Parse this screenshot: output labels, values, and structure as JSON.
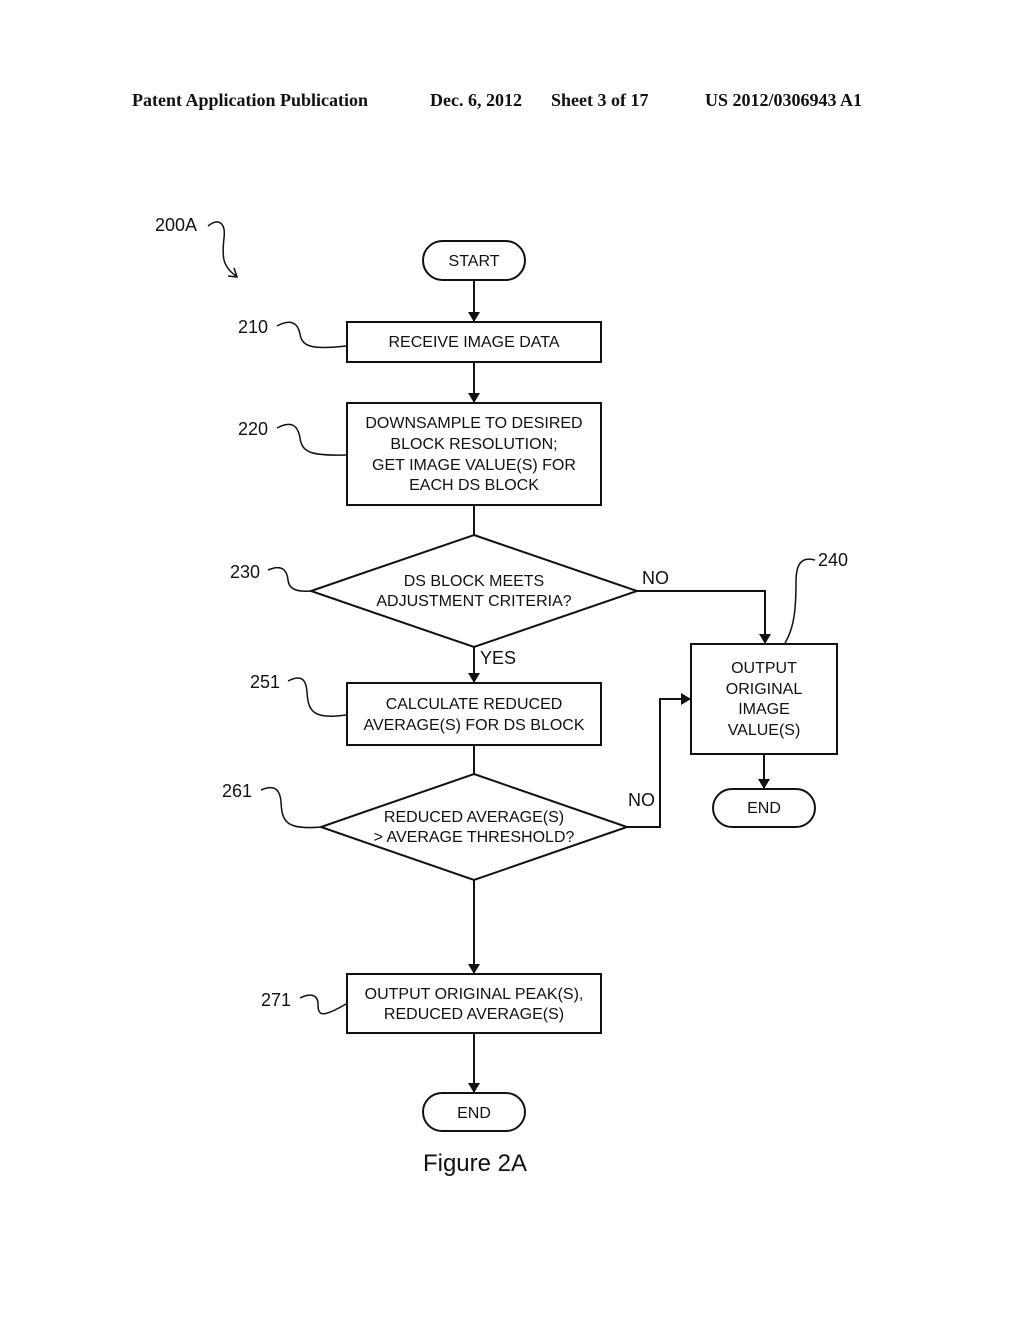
{
  "header": {
    "publication": "Patent Application Publication",
    "date": "Dec. 6, 2012",
    "sheet": "Sheet 3 of 17",
    "number": "US 2012/0306943 A1"
  },
  "figure": {
    "ref": "200A",
    "caption": "Figure 2A"
  },
  "nodes": {
    "start": {
      "text": "START"
    },
    "n210": {
      "ref": "210",
      "lines": [
        "RECEIVE IMAGE DATA"
      ]
    },
    "n220": {
      "ref": "220",
      "lines": [
        "DOWNSAMPLE TO DESIRED",
        "BLOCK RESOLUTION;",
        "GET IMAGE VALUE(S) FOR",
        "EACH DS BLOCK"
      ]
    },
    "n230": {
      "ref": "230",
      "lines": [
        "DS BLOCK MEETS",
        "ADJUSTMENT CRITERIA?"
      ]
    },
    "n240": {
      "ref": "240",
      "lines": [
        "OUTPUT",
        "ORIGINAL",
        "IMAGE",
        "VALUE(S)"
      ]
    },
    "n251": {
      "ref": "251",
      "lines": [
        "CALCULATE REDUCED",
        "AVERAGE(S) FOR DS BLOCK"
      ]
    },
    "n261": {
      "ref": "261",
      "lines": [
        "REDUCED AVERAGE(S)",
        "> AVERAGE THRESHOLD?"
      ]
    },
    "n271": {
      "ref": "271",
      "lines": [
        "OUTPUT ORIGINAL PEAK(S),",
        "REDUCED AVERAGE(S)"
      ]
    },
    "end_right": {
      "text": "END"
    },
    "end_bottom": {
      "text": "END"
    }
  },
  "edges": {
    "no_230": "NO",
    "yes_230": "YES",
    "no_261": "NO"
  }
}
